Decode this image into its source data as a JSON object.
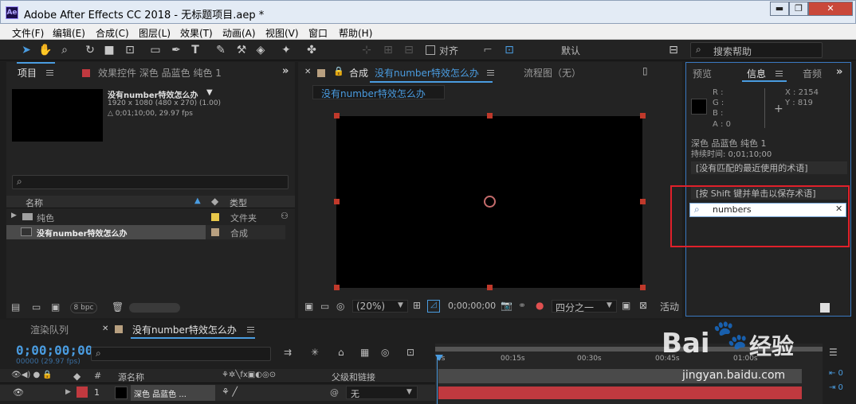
{
  "window": {
    "title": "Adobe After Effects CC 2018 - 无标题项目.aep *",
    "logo": "Ae"
  },
  "menu": [
    "文件(F)",
    "编辑(E)",
    "合成(C)",
    "图层(L)",
    "效果(T)",
    "动画(A)",
    "视图(V)",
    "窗口",
    "帮助(H)"
  ],
  "toolbar": {
    "align_label": "对齐",
    "workspace": "默认",
    "help_placeholder": "搜索帮助"
  },
  "project": {
    "tab": "项目",
    "effects_tab": "效果控件 深色 品蓝色 纯色 1",
    "item_name": "没有number特效怎么办",
    "item_res": "1920 x 1080  (480 x 270) (1.00)",
    "item_dur": "△ 0;01;10;00, 29.97 fps",
    "col_name": "名称",
    "col_type": "类型",
    "rows": [
      {
        "name": "纯色",
        "type": "文件夹",
        "color": "#e8c84a"
      },
      {
        "name": "没有number特效怎么办",
        "type": "合成",
        "color": "#b8a080"
      }
    ],
    "bpc": "8 bpc"
  },
  "composition": {
    "tab_prefix": "合成",
    "tab_name": "没有number特效怎么办",
    "flow_tab": "流程图（无）",
    "breadcrumb": "没有number特效怎么办",
    "zoom": "(20%)",
    "timecode": "0;00;00;00",
    "quality": "四分之一",
    "active": "活动"
  },
  "info": {
    "tab_preview": "预览",
    "tab_info": "信息",
    "tab_audio": "音频",
    "r": "R :",
    "g": "G :",
    "b": "B :",
    "a": "A : 0",
    "x": "X : 2154",
    "y": "Y : 819",
    "layer_name": "深色 品蓝色 纯色 1",
    "duration": "持续时间: 0;01;10;00",
    "msg1": "[没有匹配的最近使用的术语]",
    "msg2": "[按 Shift 键并单击以保存术语]",
    "search_value": "numbers"
  },
  "timeline": {
    "render_tab": "渲染队列",
    "comp_tab": "没有number特效怎么办",
    "timecode": "0;00;00;00",
    "fps": "00000 (29.97 fps)",
    "col_hash": "#",
    "col_source": "源名称",
    "col_parent": "父级和链接",
    "ticks": [
      "0s",
      "00:15s",
      "00:30s",
      "00:45s",
      "01:00s"
    ],
    "layer": {
      "index": "1",
      "name": "深色 品蓝色 ...",
      "parent": "无"
    }
  },
  "watermark": {
    "brand": "Bai",
    "brand2": "经验",
    "url": "jingyan.baidu.com"
  },
  "colors": {
    "accent": "#4a9ce0",
    "highlight": "#e0202a",
    "layer_bar": "#c0393f"
  }
}
